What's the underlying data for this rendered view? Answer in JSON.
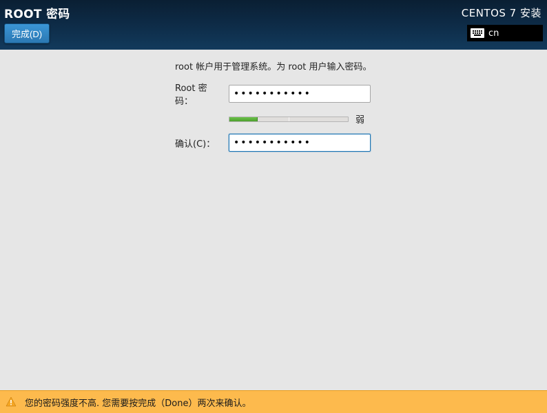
{
  "header": {
    "title": "ROOT 密码",
    "brand": "CENTOS 7 安装",
    "done_label": "完成(D)",
    "keyboard_lang": "cn"
  },
  "form": {
    "description": "root 帐户用于管理系统。为 root 用户输入密码。",
    "password_label": "Root 密码：",
    "password_value": "•••••••••••",
    "confirm_label": "确认(C)：",
    "confirm_value": "•••••••••••",
    "strength_label": "弱",
    "strength_fraction": 0.24
  },
  "footer": {
    "warning": "您的密码强度不高. 您需要按完成（Done）两次来确认。"
  }
}
